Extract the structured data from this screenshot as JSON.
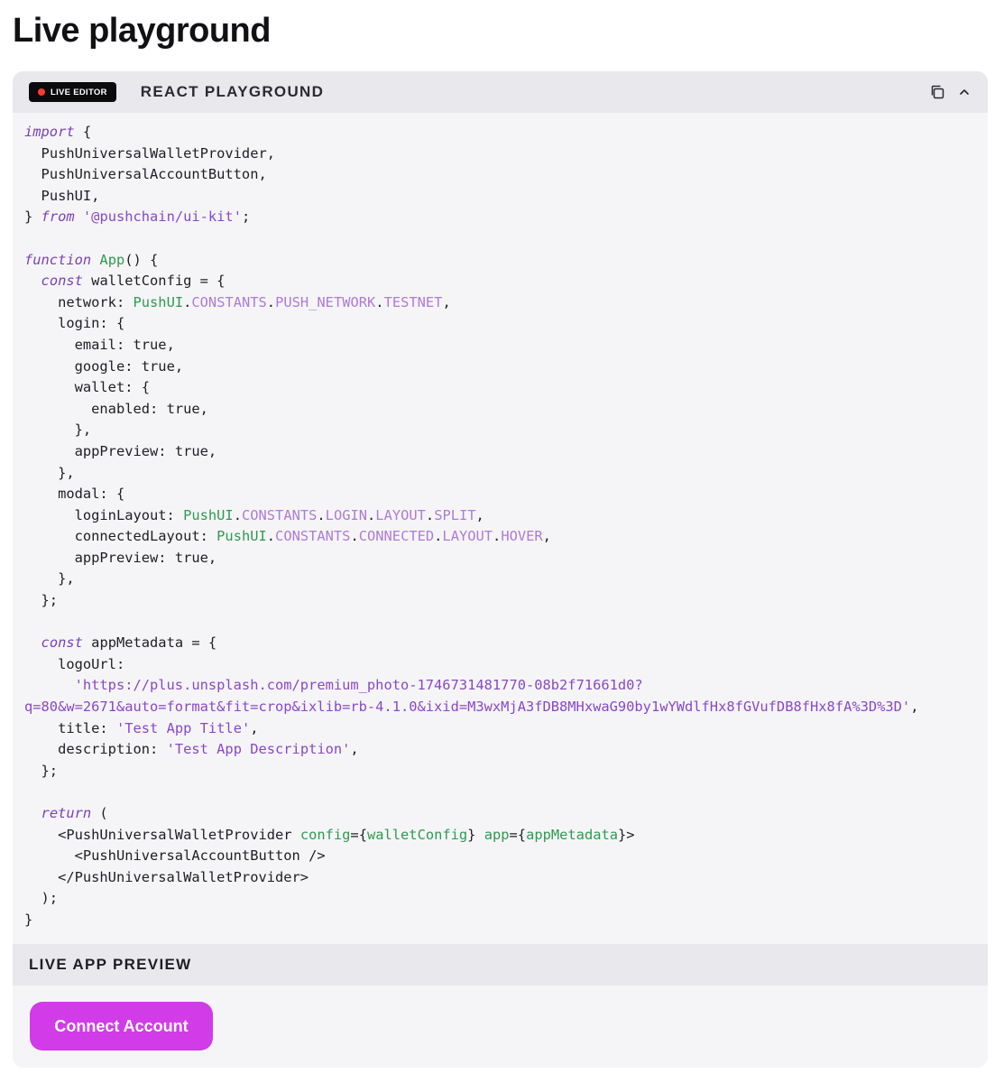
{
  "page": {
    "title": "Live playground"
  },
  "playground": {
    "badge_label": "LIVE EDITOR",
    "header_title": "REACT PLAYGROUND",
    "icons": [
      "copy-icon",
      "chevron-up-icon"
    ],
    "code": {
      "import_kw": "import",
      "import_items": [
        "PushUniversalWalletProvider",
        "PushUniversalAccountButton",
        "PushUI"
      ],
      "from_kw": "from",
      "module": "'@pushchain/ui-kit'",
      "function_kw": "function",
      "fn_name": "App",
      "const_kw": "const",
      "return_kw": "return",
      "wallet_config_name": "walletConfig",
      "network_key": "network",
      "pushui": "PushUI",
      "constants": "CONSTANTS",
      "push_network": "PUSH_NETWORK",
      "testnet": "TESTNET",
      "login_key": "login",
      "email_key": "email",
      "google_key": "google",
      "wallet_key": "wallet",
      "enabled_key": "enabled",
      "app_preview_key": "appPreview",
      "true_val": "true",
      "modal_key": "modal",
      "login_layout_key": "loginLayout",
      "login_const": "LOGIN",
      "layout_const": "LAYOUT",
      "split_const": "SPLIT",
      "connected_layout_key": "connectedLayout",
      "connected_const": "CONNECTED",
      "hover_const": "HOVER",
      "app_metadata_name": "appMetadata",
      "logo_url_key": "logoUrl",
      "logo_url_line1": "'https://plus.unsplash.com/premium_photo-1746731481770-08b2f71661d0?",
      "logo_url_line2": "q=80&w=2671&auto=format&fit=crop&ixlib=rb-4.1.0&ixid=M3wxMjA3fDB8MHxwaG90by1wYWdlfHx8fGVufDB8fHx8fA%3D%3D'",
      "title_key": "title",
      "title_val": "'Test App Title'",
      "description_key": "description",
      "description_val": "'Test App Description'",
      "provider_tag": "PushUniversalWalletProvider",
      "button_tag": "PushUniversalAccountButton",
      "config_attr": "config",
      "app_attr": "app"
    }
  },
  "preview": {
    "header_title": "LIVE APP PREVIEW",
    "connect_button_label": "Connect Account"
  },
  "colors": {
    "accent": "#d13be8",
    "keyword": "#7b3fb8",
    "identifier": "#2e9a4f",
    "constant": "#b07ad6"
  }
}
